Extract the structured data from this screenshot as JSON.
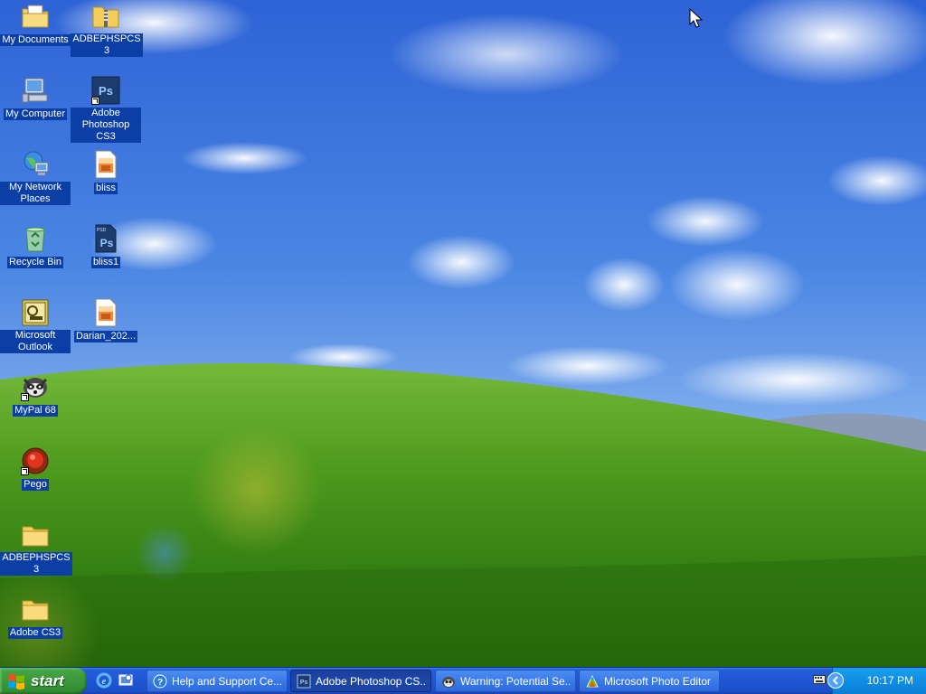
{
  "desktop": {
    "icons": [
      {
        "label": "My Documents",
        "icon": "my-documents-icon"
      },
      {
        "label": "ADBEPHSPCS3",
        "icon": "zip-folder-icon"
      },
      {
        "label": "My Computer",
        "icon": "my-computer-icon"
      },
      {
        "label": "Adobe Photoshop CS3",
        "icon": "photoshop-icon"
      },
      {
        "label": "My Network Places",
        "icon": "network-places-icon"
      },
      {
        "label": "bliss",
        "icon": "image-file-icon"
      },
      {
        "label": "Recycle Bin",
        "icon": "recycle-bin-icon"
      },
      {
        "label": "bliss1",
        "icon": "psd-file-icon"
      },
      {
        "label": "Microsoft Outlook",
        "icon": "outlook-icon"
      },
      {
        "label": "Darian_202...",
        "icon": "image-file-icon"
      },
      {
        "label": "MyPal 68",
        "icon": "mypal-icon"
      },
      {
        "label": "Pego",
        "icon": "pego-icon"
      },
      {
        "label": "ADBEPHSPCS3",
        "icon": "folder-icon"
      },
      {
        "label": "Adobe CS3",
        "icon": "folder-icon"
      }
    ]
  },
  "taskbar": {
    "start_label": "start",
    "quick_launch": [
      "internet-explorer-icon",
      "show-desktop-icon"
    ],
    "tasks": [
      {
        "label": "Help and Support Ce...",
        "icon": "help-icon"
      },
      {
        "label": "Adobe Photoshop CS...",
        "icon": "photoshop-icon"
      },
      {
        "label": "Warning: Potential Se...",
        "icon": "mypal-icon"
      },
      {
        "label": "Microsoft Photo Editor",
        "icon": "photo-editor-icon"
      }
    ],
    "clock": "10:17 PM"
  },
  "colors": {
    "taskbar_blue": "#245edb",
    "start_green": "#3c9a3c",
    "tray_blue": "#0f8de3",
    "label_highlight": "#0b3fa6"
  }
}
